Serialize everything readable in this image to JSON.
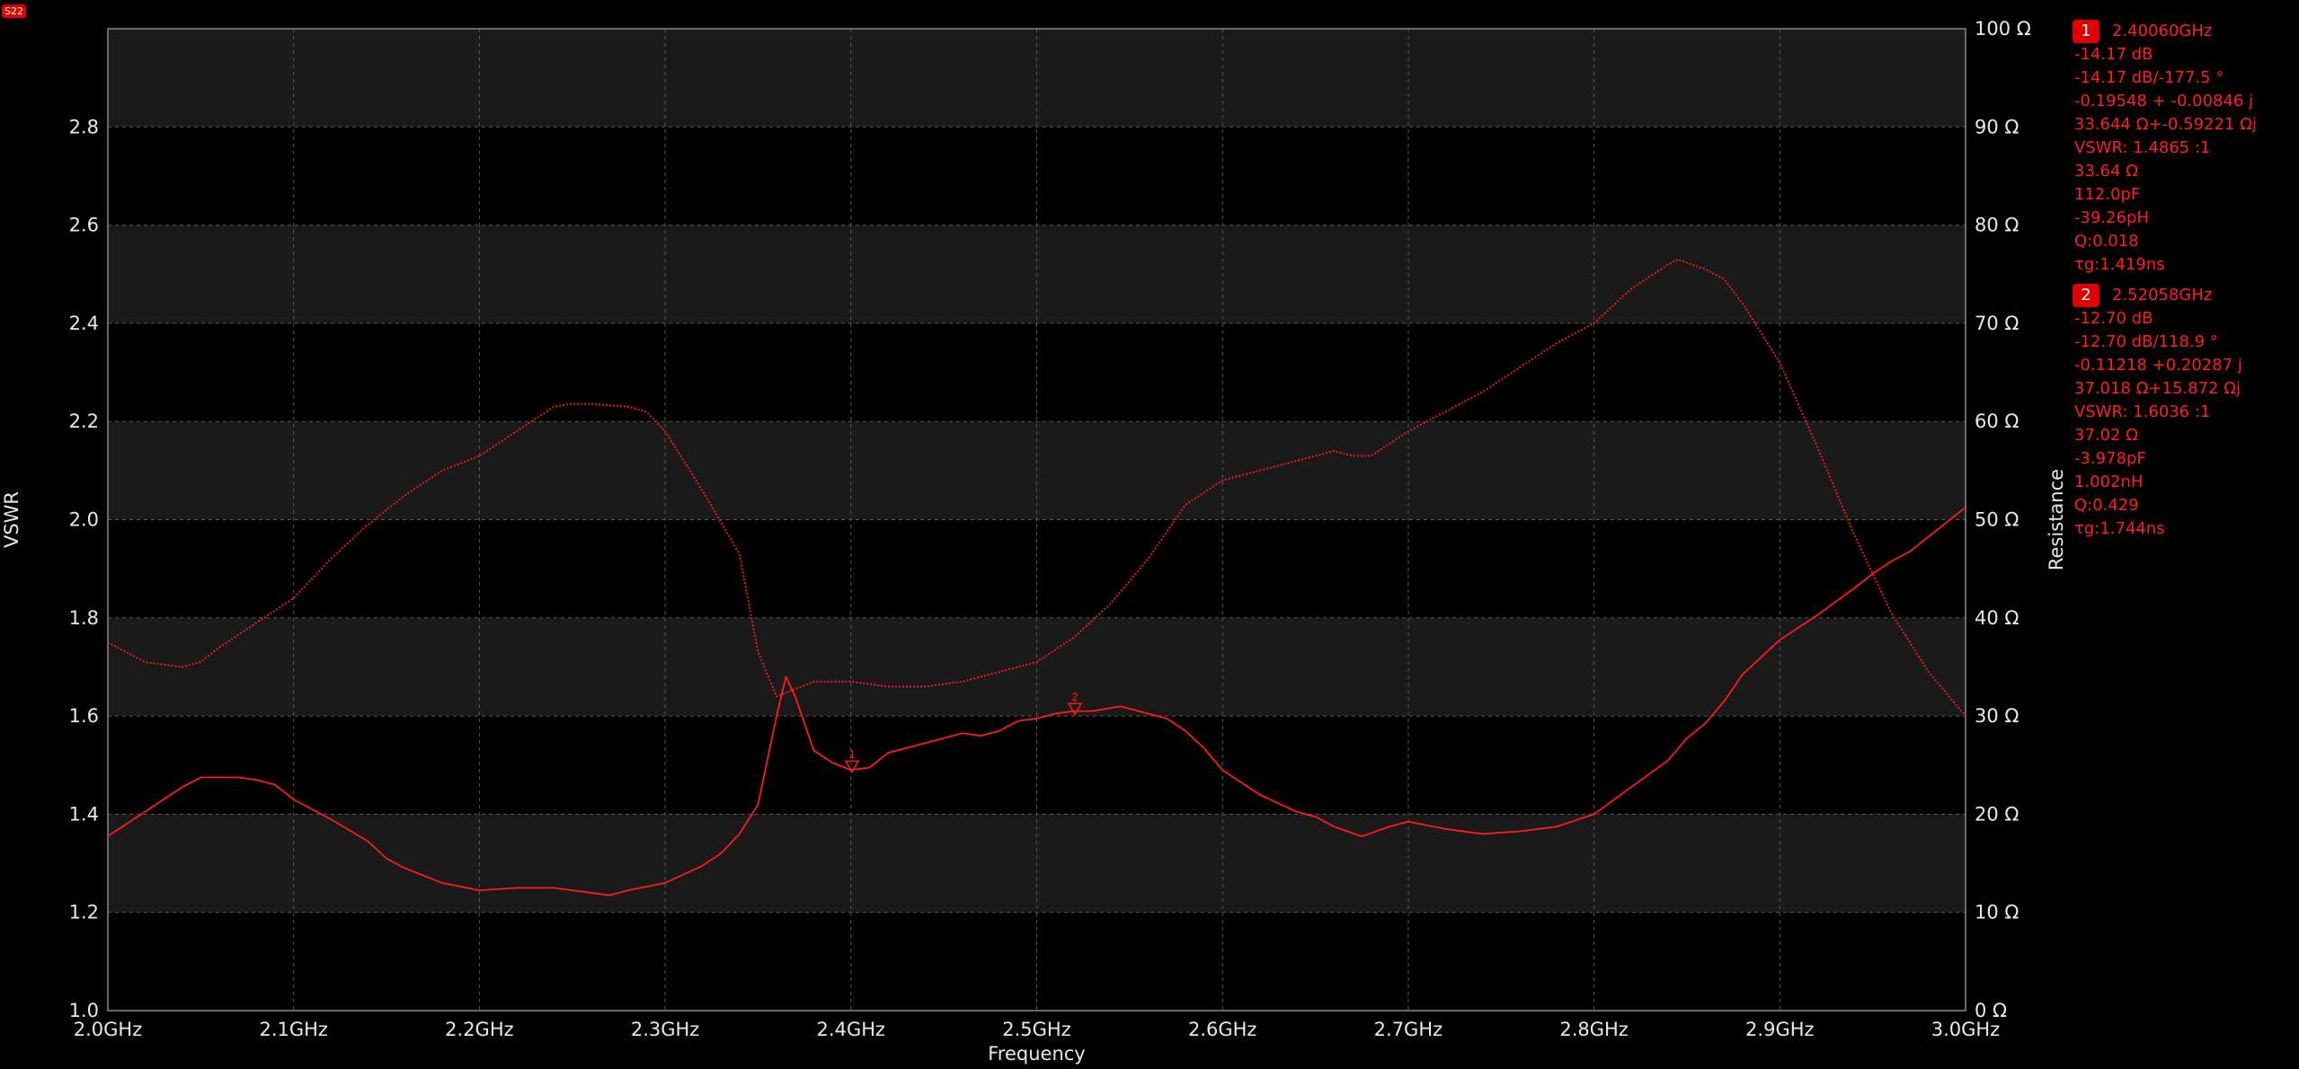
{
  "trace": {
    "label": "S22"
  },
  "colors": {
    "trace": "#ff1a1a",
    "background": "#000000",
    "band": "#1a1a1a",
    "grid": "#555555"
  },
  "chart_data": {
    "type": "line",
    "xlabel": "Frequency",
    "ylabel_left": "VSWR",
    "ylabel_right": "Resistance",
    "xlim": [
      2.0,
      3.0
    ],
    "ylim_left": [
      1.0,
      3.0
    ],
    "ylim_right": [
      0,
      100
    ],
    "x_ticks": [
      {
        "value": 2.0,
        "label": "2.0GHz"
      },
      {
        "value": 2.1,
        "label": "2.1GHz"
      },
      {
        "value": 2.2,
        "label": "2.2GHz"
      },
      {
        "value": 2.3,
        "label": "2.3GHz"
      },
      {
        "value": 2.4,
        "label": "2.4GHz"
      },
      {
        "value": 2.5,
        "label": "2.5GHz"
      },
      {
        "value": 2.6,
        "label": "2.6GHz"
      },
      {
        "value": 2.7,
        "label": "2.7GHz"
      },
      {
        "value": 2.8,
        "label": "2.8GHz"
      },
      {
        "value": 2.9,
        "label": "2.9GHz"
      },
      {
        "value": 3.0,
        "label": "3.0GHz"
      }
    ],
    "y_left_ticks": [
      {
        "value": 1.0,
        "label": "1.0"
      },
      {
        "value": 1.2,
        "label": "1.2"
      },
      {
        "value": 1.4,
        "label": "1.4"
      },
      {
        "value": 1.6,
        "label": "1.6"
      },
      {
        "value": 1.8,
        "label": "1.8"
      },
      {
        "value": 2.0,
        "label": "2.0"
      },
      {
        "value": 2.2,
        "label": "2.2"
      },
      {
        "value": 2.4,
        "label": "2.4"
      },
      {
        "value": 2.6,
        "label": "2.6"
      },
      {
        "value": 2.8,
        "label": "2.8"
      }
    ],
    "y_right_ticks": [
      {
        "value": 0,
        "label": "0 Ω"
      },
      {
        "value": 10,
        "label": "10 Ω"
      },
      {
        "value": 20,
        "label": "20 Ω"
      },
      {
        "value": 30,
        "label": "30 Ω"
      },
      {
        "value": 40,
        "label": "40 Ω"
      },
      {
        "value": 50,
        "label": "50 Ω"
      },
      {
        "value": 60,
        "label": "60 Ω"
      },
      {
        "value": 70,
        "label": "70 Ω"
      },
      {
        "value": 80,
        "label": "80 Ω"
      },
      {
        "value": 90,
        "label": "90 Ω"
      },
      {
        "value": 100,
        "label": "100 Ω"
      }
    ],
    "grid": true,
    "series": [
      {
        "axis": "left",
        "style": "solid",
        "x": [
          2.0,
          2.01,
          2.02,
          2.03,
          2.04,
          2.05,
          2.06,
          2.07,
          2.08,
          2.09,
          2.1,
          2.12,
          2.14,
          2.15,
          2.16,
          2.18,
          2.2,
          2.22,
          2.24,
          2.26,
          2.27,
          2.28,
          2.3,
          2.32,
          2.33,
          2.34,
          2.35,
          2.36,
          2.365,
          2.37,
          2.38,
          2.39,
          2.4,
          2.41,
          2.42,
          2.43,
          2.44,
          2.45,
          2.46,
          2.47,
          2.48,
          2.49,
          2.5,
          2.51,
          2.52,
          2.53,
          2.545,
          2.56,
          2.57,
          2.58,
          2.59,
          2.6,
          2.62,
          2.64,
          2.65,
          2.66,
          2.675,
          2.69,
          2.7,
          2.72,
          2.74,
          2.76,
          2.78,
          2.8,
          2.82,
          2.84,
          2.85,
          2.86,
          2.87,
          2.88,
          2.9,
          2.92,
          2.94,
          2.95,
          2.96,
          2.97,
          2.98,
          3.0
        ],
        "y": [
          1.355,
          1.38,
          1.405,
          1.43,
          1.455,
          1.475,
          1.475,
          1.475,
          1.47,
          1.46,
          1.43,
          1.39,
          1.345,
          1.31,
          1.29,
          1.26,
          1.245,
          1.25,
          1.25,
          1.24,
          1.235,
          1.245,
          1.26,
          1.295,
          1.32,
          1.36,
          1.42,
          1.6,
          1.68,
          1.64,
          1.53,
          1.505,
          1.49,
          1.495,
          1.525,
          1.535,
          1.545,
          1.555,
          1.565,
          1.56,
          1.57,
          1.59,
          1.595,
          1.605,
          1.61,
          1.61,
          1.62,
          1.605,
          1.595,
          1.57,
          1.535,
          1.49,
          1.44,
          1.405,
          1.395,
          1.375,
          1.355,
          1.375,
          1.385,
          1.37,
          1.36,
          1.365,
          1.375,
          1.4,
          1.455,
          1.51,
          1.555,
          1.585,
          1.63,
          1.685,
          1.755,
          1.805,
          1.86,
          1.89,
          1.915,
          1.935,
          1.965,
          2.025
        ]
      },
      {
        "axis": "right",
        "style": "dotted",
        "x": [
          2.0,
          2.02,
          2.04,
          2.05,
          2.06,
          2.08,
          2.1,
          2.12,
          2.14,
          2.16,
          2.18,
          2.2,
          2.22,
          2.24,
          2.25,
          2.26,
          2.28,
          2.29,
          2.3,
          2.32,
          2.34,
          2.35,
          2.36,
          2.38,
          2.39,
          2.4,
          2.42,
          2.44,
          2.46,
          2.48,
          2.5,
          2.52,
          2.54,
          2.56,
          2.58,
          2.6,
          2.62,
          2.64,
          2.66,
          2.67,
          2.68,
          2.7,
          2.72,
          2.74,
          2.76,
          2.78,
          2.8,
          2.82,
          2.84,
          2.845,
          2.86,
          2.87,
          2.88,
          2.9,
          2.92,
          2.94,
          2.96,
          2.98,
          3.0
        ],
        "y": [
          37.5,
          35.5,
          35,
          35.5,
          37,
          39.5,
          42,
          46,
          49.5,
          52.5,
          55,
          56.5,
          59,
          61.5,
          61.8,
          61.8,
          61.5,
          61,
          59,
          53,
          46.5,
          36.5,
          32,
          33.5,
          33.5,
          33.5,
          33,
          33,
          33.5,
          34.5,
          35.5,
          38,
          41.5,
          46,
          51.5,
          54,
          55,
          56,
          57,
          56.5,
          56.5,
          59,
          61,
          63,
          65.5,
          68,
          70,
          73.5,
          76,
          76.5,
          75.5,
          74.5,
          72,
          66,
          57.5,
          48.5,
          40.5,
          34.5,
          30
        ]
      }
    ],
    "markers": [
      {
        "id": "1",
        "x": 2.4006,
        "y": 1.4865,
        "label": "1"
      },
      {
        "id": "2",
        "x": 2.52058,
        "y": 1.6036,
        "label": "2"
      }
    ]
  },
  "marker_readouts": [
    {
      "number": "1",
      "lines": [
        "2.40060GHz",
        "-14.17 dB",
        "-14.17 dB/-177.5 °",
        "-0.19548 + -0.00846 j",
        "33.644 Ω+-0.59221 Ωj",
        "VSWR: 1.4865 :1",
        "33.64 Ω",
        "112.0pF",
        "-39.26pH",
        "Q:0.018",
        "τg:1.419ns"
      ]
    },
    {
      "number": "2",
      "lines": [
        "2.52058GHz",
        "-12.70 dB",
        "-12.70 dB/118.9 °",
        "-0.11218 +0.20287 j",
        "37.018 Ω+15.872 Ωj",
        "VSWR: 1.6036 :1",
        "37.02 Ω",
        "-3.978pF",
        "1.002nH",
        "Q:0.429",
        "τg:1.744ns"
      ]
    }
  ]
}
